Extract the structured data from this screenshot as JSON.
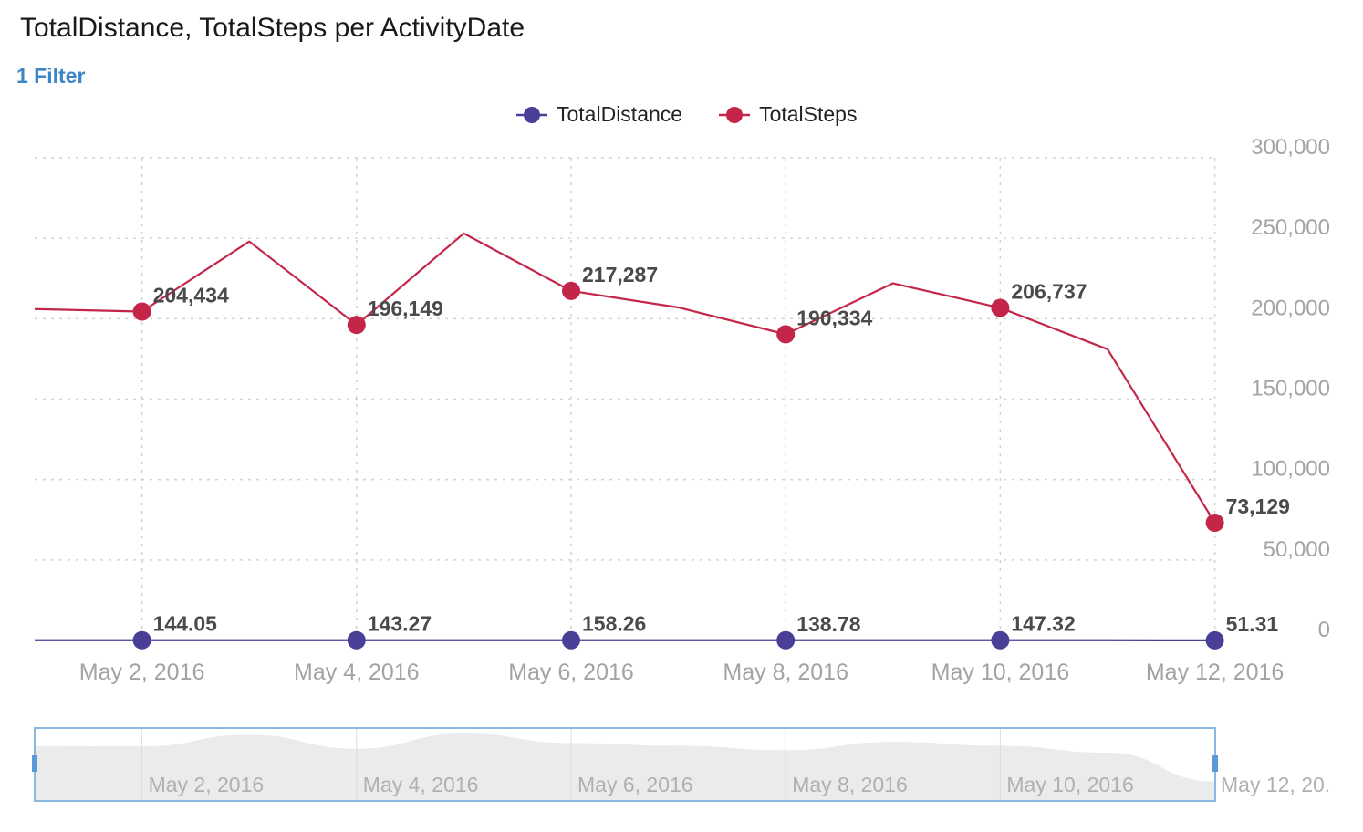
{
  "header": {
    "title": "TotalDistance, TotalSteps per ActivityDate",
    "filter_label": "1 Filter"
  },
  "colors": {
    "total_distance": "#4a3f96",
    "total_steps": "#c4264a",
    "grid": "#d2d2d2",
    "navigator_fill": "#ebebeb",
    "navigator_border": "#8ab8e0"
  },
  "chart_data": {
    "type": "line",
    "title": "TotalDistance, TotalSteps per ActivityDate",
    "x_tick_labels": [
      "May 2, 2016",
      "May 4, 2016",
      "May 6, 2016",
      "May 8, 2016",
      "May 10, 2016",
      "May 12, 2016"
    ],
    "y_tick_labels": [
      "300,000",
      "250,000",
      "200,000",
      "150,000",
      "100,000",
      "50,000",
      "0"
    ],
    "ylim": [
      0,
      300000
    ],
    "grid": true,
    "legend_position": "top-center",
    "x": [
      "May 1, 2016",
      "May 2, 2016",
      "May 3, 2016",
      "May 4, 2016",
      "May 5, 2016",
      "May 6, 2016",
      "May 7, 2016",
      "May 8, 2016",
      "May 9, 2016",
      "May 10, 2016",
      "May 11, 2016",
      "May 12, 2016"
    ],
    "series": [
      {
        "name": "TotalDistance",
        "values": [
          144,
          144.05,
          150,
          143.27,
          152,
          158.26,
          146,
          138.78,
          153,
          147.32,
          125,
          51.31
        ],
        "labels": [
          null,
          "144.05",
          null,
          "143.27",
          null,
          "158.26",
          null,
          "138.78",
          null,
          "147.32",
          null,
          "51.31"
        ]
      },
      {
        "name": "TotalSteps",
        "values": [
          206000,
          204434,
          248000,
          196149,
          253000,
          217287,
          207000,
          190334,
          222000,
          206737,
          181000,
          73129
        ],
        "labels": [
          null,
          "204,434",
          null,
          "196,149",
          null,
          "217,287",
          null,
          "190,334",
          null,
          "206,737",
          null,
          "73,129"
        ]
      }
    ]
  },
  "navigator": {
    "tick_labels": [
      "May 2, 2016",
      "May 4, 2016",
      "May 6, 2016",
      "May 8, 2016",
      "May 10, 2016"
    ],
    "overflow_label": "May 12, 20."
  }
}
